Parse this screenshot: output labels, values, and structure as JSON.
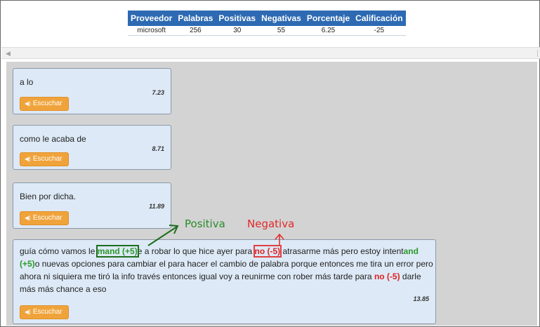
{
  "summary": {
    "headers": [
      "Proveedor",
      "Palabras",
      "Positivas",
      "Negativas",
      "Porcentaje",
      "Calificación"
    ],
    "row": [
      "microsoft",
      "256",
      "30",
      "55",
      "6.25",
      "-25"
    ]
  },
  "colors": {
    "header_blue": "#2d6ab3",
    "positive": "#2a9a2a",
    "negative": "#e02020",
    "button_orange": "#f0a33a",
    "card_bg": "#dde9f6",
    "content_bg": "#d3d3d3"
  },
  "listen_button": {
    "label": "Escuchar",
    "icon": "speaker-icon"
  },
  "cards": [
    {
      "text": "a lo",
      "time": "7.23"
    },
    {
      "text": "como le acaba de",
      "time": "8.71"
    },
    {
      "text": "Bien por dicha.",
      "time": "11.89"
    },
    {
      "time": "13.85",
      "segments": {
        "s1": "guía cómo vamos le ",
        "k1": "mand (+5)",
        "s2": "e a robar lo que hice ayer para ",
        "k2": "no (-5)",
        "s3": " atrasarme más pero estoy intent",
        "k3": "and (+5)",
        "s4": "o nuevas opciones para cambiar el para hacer el cambio de palabra porque entonces me tira un error pero ahora ni siquiera me tiró la info través entonces igual voy a reunirme con rober más tarde para ",
        "k4": "no (-5)",
        "s5": " darle más más chance a eso"
      }
    }
  ],
  "annotations": {
    "positive": "Positiva",
    "negative": "Negativa"
  }
}
